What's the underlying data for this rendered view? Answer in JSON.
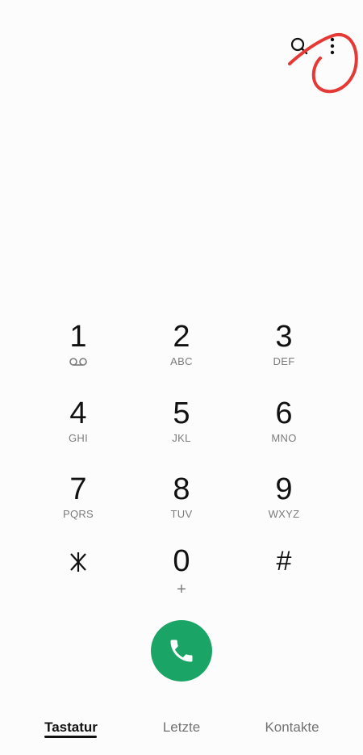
{
  "toolbar": {
    "search_icon": "search-icon",
    "more_icon": "more-vert-icon"
  },
  "keypad": {
    "keys": [
      {
        "digit": "1",
        "letters": "",
        "sub_icon": "voicemail-icon"
      },
      {
        "digit": "2",
        "letters": "ABC"
      },
      {
        "digit": "3",
        "letters": "DEF"
      },
      {
        "digit": "4",
        "letters": "GHI"
      },
      {
        "digit": "5",
        "letters": "JKL"
      },
      {
        "digit": "6",
        "letters": "MNO"
      },
      {
        "digit": "7",
        "letters": "PQRS"
      },
      {
        "digit": "8",
        "letters": "TUV"
      },
      {
        "digit": "9",
        "letters": "WXYZ"
      },
      {
        "digit": "*",
        "letters": ""
      },
      {
        "digit": "0",
        "letters": "+"
      },
      {
        "digit": "#",
        "letters": ""
      }
    ]
  },
  "call": {
    "icon": "phone-icon",
    "color": "#1aa566"
  },
  "tabs": [
    {
      "label": "Tastatur",
      "active": true
    },
    {
      "label": "Letzte",
      "active": false
    },
    {
      "label": "Kontakte",
      "active": false
    }
  ],
  "colors": {
    "background": "#fcfcfc",
    "annotation": "#e53935"
  }
}
